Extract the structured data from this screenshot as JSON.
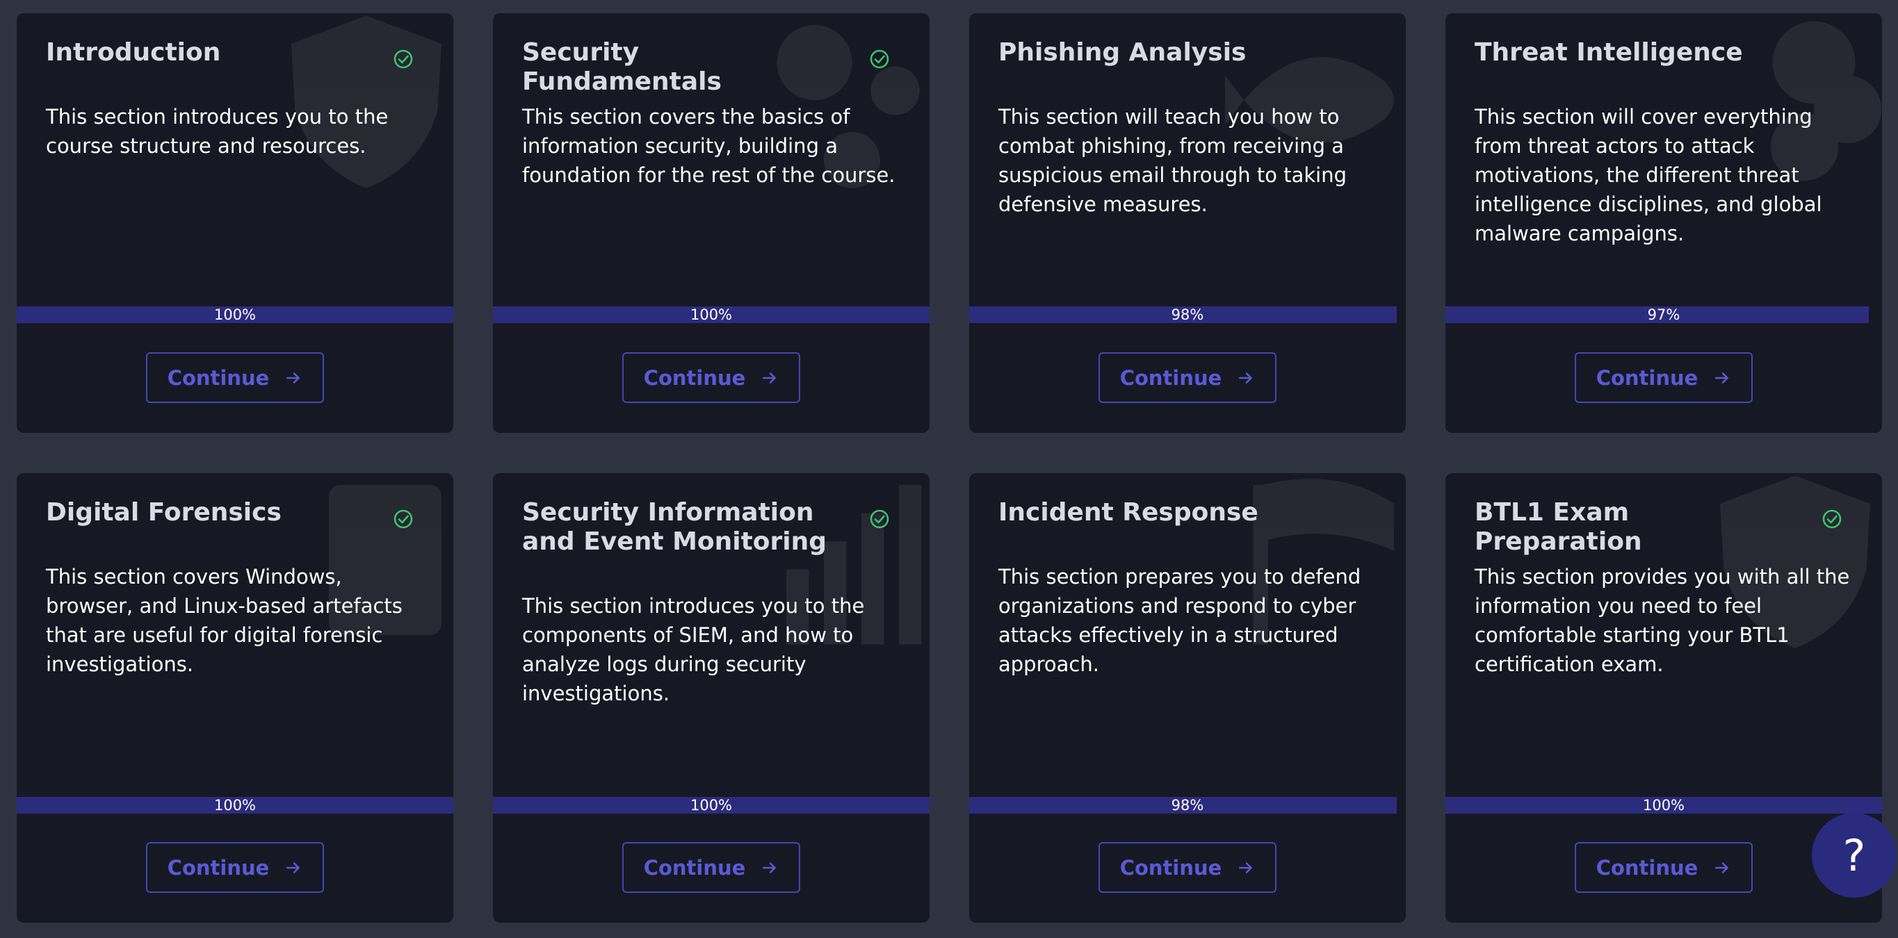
{
  "cards": [
    {
      "title": "Introduction",
      "completed": true,
      "description": "This section introduces you to the course structure and resources.",
      "progress_label": "100%",
      "progress": 100,
      "button_label": "Continue",
      "deco_icon": "shield-icon"
    },
    {
      "title": "Security Fundamentals",
      "completed": true,
      "description": "This section covers the basics of information security, building a foundation for the rest of the course.",
      "progress_label": "100%",
      "progress": 100,
      "button_label": "Continue",
      "deco_icon": "gears-icon"
    },
    {
      "title": "Phishing Analysis",
      "completed": false,
      "description": "This section will teach you how to combat phishing, from receiving a suspicious email through to taking defensive measures.",
      "progress_label": "98%",
      "progress": 98,
      "button_label": "Continue",
      "deco_icon": "fish-icon"
    },
    {
      "title": "Threat Intelligence",
      "completed": false,
      "description": "This section will cover everything from threat actors to attack motivations, the different threat intelligence disciplines, and global malware campaigns.",
      "progress_label": "97%",
      "progress": 97,
      "button_label": "Continue",
      "deco_icon": "brain-icon"
    },
    {
      "title": "Digital Forensics",
      "completed": true,
      "description": "This section covers Windows, browser, and Linux-based artefacts that are useful for digital forensic investigations.",
      "progress_label": "100%",
      "progress": 100,
      "button_label": "Continue",
      "deco_icon": "fingerprint-icon"
    },
    {
      "title": "Security Information and Event Monitoring",
      "completed": true,
      "description": "This section introduces you to the components of SIEM, and how to analyze logs during security investigations.",
      "progress_label": "100%",
      "progress": 100,
      "button_label": "Continue",
      "deco_icon": "chart-icon"
    },
    {
      "title": "Incident Response",
      "completed": false,
      "description": "This section prepares you to defend organizations and respond to cyber attacks effectively in a structured approach.",
      "progress_label": "98%",
      "progress": 98,
      "button_label": "Continue",
      "deco_icon": "flag-icon"
    },
    {
      "title": "BTL1 Exam Preparation",
      "completed": true,
      "description": "This section provides you with all the information you need to feel comfortable starting your BTL1 certification exam.",
      "progress_label": "100%",
      "progress": 100,
      "button_label": "Continue",
      "deco_icon": "shield-icon"
    }
  ],
  "help_button": {
    "label": "?"
  },
  "colors": {
    "accent": "#5b59d6",
    "progress_fill": "#2c2c7e",
    "check": "#3ec46d",
    "card_bg": "#161923",
    "page_bg": "#2f3341"
  }
}
